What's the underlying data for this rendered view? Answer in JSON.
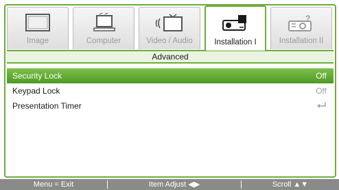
{
  "tabs": [
    {
      "label": "Image",
      "icon": "monitor-icon"
    },
    {
      "label": "Computer",
      "icon": "computer-icon"
    },
    {
      "label": "Video / Audio",
      "icon": "video-audio-icon"
    },
    {
      "label": "Installation I",
      "icon": "projector-icon",
      "active": true
    },
    {
      "label": "Installation II",
      "icon": "projector-settings-icon"
    }
  ],
  "section_title": "Advanced",
  "menu_items": [
    {
      "label": "Security Lock",
      "value": "Off",
      "selected": true
    },
    {
      "label": "Keypad Lock",
      "value": "Off"
    },
    {
      "label": "Presentation Timer",
      "value_icon": "enter-icon"
    }
  ],
  "footer": {
    "exit": "Menu = Exit",
    "adjust": "Item Adjust",
    "scroll": "Scroll"
  },
  "colors": {
    "accent": "#6cad3a",
    "highlight": "#5aa82f",
    "footer_bg": "#8a8a8a"
  }
}
